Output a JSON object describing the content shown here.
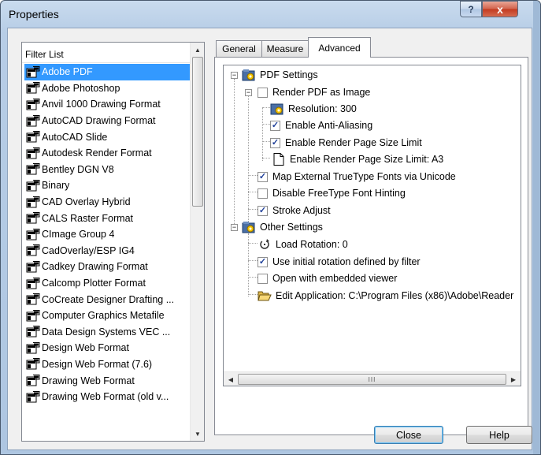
{
  "window": {
    "title": "Properties",
    "help_glyph": "?",
    "close_glyph": "x"
  },
  "filter_list": {
    "header": "Filter List",
    "scroll_up": "▲",
    "scroll_down": "▼",
    "items": [
      "Adobe PDF",
      "Adobe Photoshop",
      "Anvil 1000 Drawing Format",
      "AutoCAD Drawing Format",
      "AutoCAD Slide",
      "Autodesk Render Format",
      "Bentley DGN V8",
      "Binary",
      "CAD Overlay Hybrid",
      "CALS Raster Format",
      "CImage Group 4",
      "CadOverlay/ESP IG4",
      "Cadkey Drawing Format",
      "Calcomp Plotter Format",
      "CoCreate Designer Drafting ...",
      "Computer Graphics Metafile",
      "Data Design Systems VEC ...",
      "Design Web Format",
      "Design Web Format (7.6)",
      "Drawing Web Format",
      "Drawing Web Format (old v..."
    ],
    "selected_index": 0
  },
  "tabs": {
    "general": "General",
    "measure": "Measure",
    "advanced": "Advanced",
    "active": "Advanced"
  },
  "tree": {
    "pdf_settings": "PDF Settings",
    "render_pdf_as_image": "Render PDF as Image",
    "resolution": "Resolution: 300",
    "enable_anti_aliasing": "Enable Anti-Aliasing",
    "enable_page_size_limit": "Enable Render Page Size Limit",
    "page_size_limit": "Enable Render Page Size Limit: A3",
    "map_truetype": "Map External TrueType Fonts via Unicode",
    "disable_freetype": "Disable FreeType Font Hinting",
    "stroke_adjust": "Stroke Adjust",
    "other_settings": "Other Settings",
    "load_rotation": "Load Rotation: 0",
    "use_initial_rotation": "Use initial rotation defined by filter",
    "open_embedded_viewer": "Open with embedded viewer",
    "edit_application": "Edit Application: C:\\Program Files (x86)\\Adobe\\Reader",
    "expander_minus": "−",
    "checked": {
      "render_pdf_as_image": false,
      "enable_anti_aliasing": true,
      "enable_page_size_limit": true,
      "map_truetype": true,
      "disable_freetype": false,
      "stroke_adjust": true,
      "use_initial_rotation": true,
      "open_embedded_viewer": false
    },
    "scroll_left": "◀",
    "scroll_right": "▶",
    "scroll_grip": "III"
  },
  "buttons": {
    "close": "Close",
    "help": "Help"
  }
}
